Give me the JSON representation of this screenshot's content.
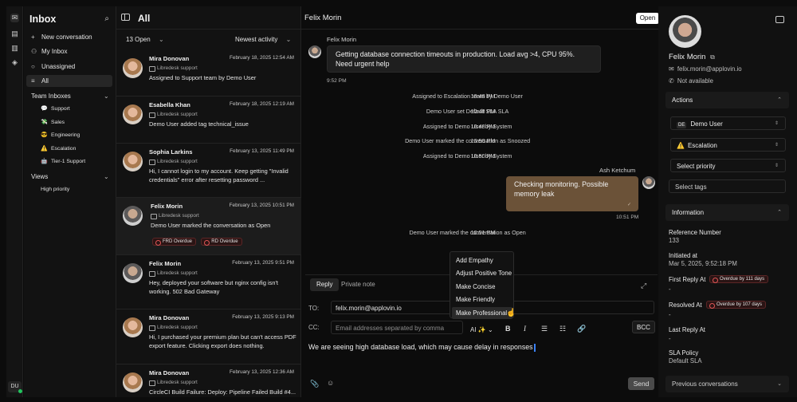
{
  "sidebar": {
    "title": "Inbox",
    "nav": [
      {
        "label": "New conversation",
        "icon": "plus-icon"
      },
      {
        "label": "My Inbox",
        "icon": "user-icon"
      },
      {
        "label": "Unassigned",
        "icon": "circle-icon"
      },
      {
        "label": "All",
        "icon": "list-icon"
      }
    ],
    "team_inboxes_label": "Team Inboxes",
    "teams": [
      {
        "label": "Support",
        "icon": "💬"
      },
      {
        "label": "Sales",
        "icon": "💸"
      },
      {
        "label": "Engineering",
        "icon": "😎"
      },
      {
        "label": "Escalation",
        "icon": "⚠️"
      },
      {
        "label": "Tier-1 Support",
        "icon": "🤖"
      }
    ],
    "views_label": "Views",
    "views": [
      {
        "label": "High priority"
      }
    ],
    "user_initials": "DU"
  },
  "list": {
    "header_title": "All",
    "count_filter": "13 Open",
    "sort_filter": "Newest activity",
    "conversations": [
      {
        "name": "Mira Donovan",
        "date": "February 18, 2025 12:54 AM",
        "inbox": "Libredesk support",
        "message": "Assigned to Support team by Demo User"
      },
      {
        "name": "Esabella Khan",
        "date": "February 18, 2025 12:19 AM",
        "inbox": "Libredesk support",
        "message": "Demo User added tag technical_issue"
      },
      {
        "name": "Sophia Larkins",
        "date": "February 13, 2025 11:49 PM",
        "inbox": "Libredesk support",
        "message": "Hi, I cannot login to my account. Keep getting \"Invalid credentials\" error after resetting password ..."
      },
      {
        "name": "Felix Morin",
        "date": "February 13, 2025 10:51 PM",
        "inbox": "Libredesk support",
        "message": "Demo User marked the conversation as Open",
        "tags": [
          "FRD Overdue",
          "RD Overdue"
        ]
      },
      {
        "name": "Felix Morin",
        "date": "February 13, 2025 9:51 PM",
        "inbox": "Libredesk support",
        "message": "Hey, deployed your software but nginx config isn't working. 502 Bad Gateway"
      },
      {
        "name": "Mira Donovan",
        "date": "February 13, 2025 9:13 PM",
        "inbox": "Libredesk support",
        "message": "Hi, I purchased your premium plan but can't access PDF export feature. Clicking export does nothing."
      },
      {
        "name": "Mira Donovan",
        "date": "February 13, 2025 12:36 AM",
        "inbox": "Libredesk support",
        "message": "CircleCI Build Failure: Deploy: Pipeline Failed Build #4..."
      }
    ]
  },
  "chat": {
    "contact_name": "Felix Morin",
    "status": "Open",
    "customer_name": "Felix Morin",
    "customer_message": "Getting database connection timeouts in production. Load avg >4, CPU 95%. Need urgent help",
    "customer_time": "9:52 PM",
    "system_events": [
      {
        "text": "Assigned to Escalation team by Demo User",
        "time": "10:48 PM"
      },
      {
        "text": "Demo User set Default SLA SLA",
        "time": "10:48 PM"
      },
      {
        "text": "Assigned to Demo User by System",
        "time": "10:48 PM"
      },
      {
        "text": "Demo User marked the conversation as Snoozed",
        "time": "10:50 PM"
      },
      {
        "text": "Assigned to Demo User by System",
        "time": "10:50 PM"
      }
    ],
    "agent_name": "Ash Ketchum",
    "agent_message": "Checking monitoring. Possible memory leak",
    "agent_time": "10:51 PM",
    "last_event": {
      "text": "Demo User marked the conversation as Open",
      "time": "10:51 PM"
    }
  },
  "ai_menu": [
    "Add Empathy",
    "Adjust Positive Tone",
    "Make Concise",
    "Make Friendly",
    "Make Professional"
  ],
  "composer": {
    "tabs": [
      "Reply",
      "Private note"
    ],
    "to_label": "TO:",
    "to_value": "felix.morin@applovin.io",
    "cc_label": "CC:",
    "cc_placeholder": "Email addresses separated by comma",
    "ai_label": "AI",
    "bcc_label": "BCC",
    "draft": "We are seeing high database load, which may cause delay in responses",
    "send_label": "Send"
  },
  "contact": {
    "name": "Felix Morin",
    "email": "felix.morin@applovin.io",
    "phone": "Not available",
    "actions_label": "Actions",
    "assignee": "Demo User",
    "assignee_initials": "DE",
    "team": "Escalation",
    "priority_placeholder": "Select priority",
    "tags_placeholder": "Select tags",
    "information_label": "Information",
    "fields": [
      {
        "label": "Reference Number",
        "value": "133"
      },
      {
        "label": "Initiated at",
        "value": "Mar 5, 2025, 9:52:18 PM"
      },
      {
        "label": "First Reply At",
        "value": "-",
        "badge": "Overdue by 111 days"
      },
      {
        "label": "Resolved At",
        "value": "-",
        "badge": "Overdue by 107 days"
      },
      {
        "label": "Last Reply At",
        "value": "-"
      },
      {
        "label": "SLA Policy",
        "value": "Default SLA"
      }
    ],
    "previous_label": "Previous conversations"
  }
}
